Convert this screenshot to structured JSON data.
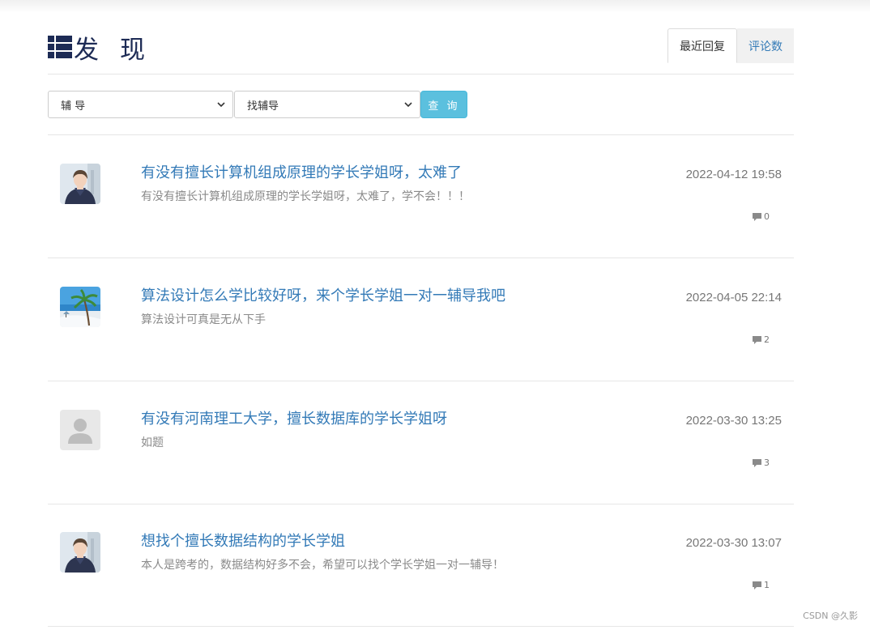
{
  "header": {
    "title": "发现",
    "tabs": [
      {
        "label": "最近回复",
        "active": true
      },
      {
        "label": "评论数",
        "active": false
      }
    ]
  },
  "filters": {
    "category_value": "辅 导",
    "subcategory_value": "找辅导",
    "search_label": "查 询"
  },
  "posts": [
    {
      "title": "有没有擅长计算机组成原理的学长学姐呀，太难了",
      "desc": "有没有擅长计算机组成原理的学长学姐呀，太难了，学不会！！！",
      "date": "2022-04-12 19:58",
      "comments": "0",
      "avatar": "anime-boy-avatar"
    },
    {
      "title": "算法设计怎么学比较好呀，来个学长学姐一对一辅导我吧",
      "desc": "算法设计可真是无从下手",
      "date": "2022-04-05 22:14",
      "comments": "2",
      "avatar": "beach-palm-avatar"
    },
    {
      "title": "有没有河南理工大学，擅长数据库的学长学姐呀",
      "desc": "如题",
      "date": "2022-03-30 13:25",
      "comments": "3",
      "avatar": "default-user-avatar"
    },
    {
      "title": "想找个擅长数据结构的学长学姐",
      "desc": "本人是跨考的，数据结构好多不会，希望可以找个学长学姐一对一辅导！",
      "date": "2022-03-30 13:07",
      "comments": "1",
      "avatar": "anime-boy-avatar"
    }
  ],
  "watermark": "CSDN @久影",
  "colors": {
    "title": "#1d2b55",
    "link": "#337ab7",
    "button": "#5bc0de"
  }
}
